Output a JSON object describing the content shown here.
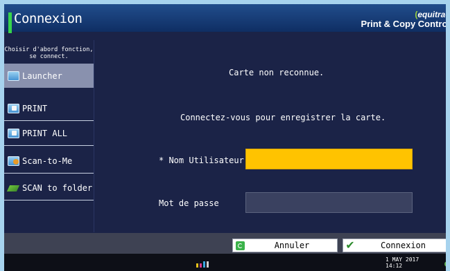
{
  "header": {
    "title": "Connexion",
    "brand_logo": "equitrac",
    "brand_sub": "Print & Copy Control"
  },
  "sidebar": {
    "hint_line1": "Choisir d'abord fonction,",
    "hint_line2": "se connect.",
    "items": [
      {
        "label": "Launcher",
        "icon": "launcher-icon",
        "active": true
      },
      {
        "label": "PRINT",
        "icon": "print-icon",
        "active": false
      },
      {
        "label": "PRINT ALL",
        "icon": "print-all-icon",
        "active": false
      },
      {
        "label": "Scan-to-Me",
        "icon": "scan-to-me-icon",
        "active": false
      },
      {
        "label": "SCAN to folder",
        "icon": "scan-to-folder-icon",
        "active": false
      }
    ]
  },
  "main": {
    "message1": "Carte non reconnue.",
    "message2": "Connectez-vous pour enregistrer la carte.",
    "username_label": "* Nom Utilisateur",
    "username_value": "",
    "password_label": "Mot de passe",
    "password_value": ""
  },
  "footer": {
    "cancel_label": "Annuler",
    "login_label": "Connexion"
  },
  "status": {
    "date": "1 MAY  2017",
    "time": "14:12"
  },
  "colors": {
    "background": "#1b2347",
    "header": "#1a3f7a",
    "accent_green": "#37d44c",
    "username_field": "#ffc300",
    "active_item": "#8991ae"
  }
}
